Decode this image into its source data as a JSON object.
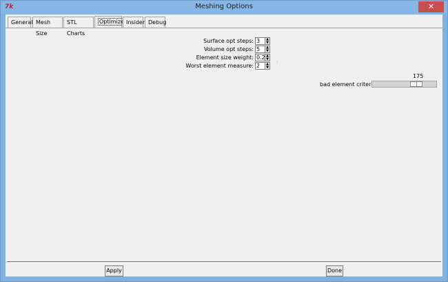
{
  "window": {
    "title": "Meshing Options",
    "app_icon_text": "7k",
    "close_symbol": "✕"
  },
  "tabs": [
    {
      "label": "General",
      "active": false
    },
    {
      "label": "Mesh Size",
      "active": false
    },
    {
      "label": "STL Charts",
      "active": false
    },
    {
      "label": "Optimizer",
      "active": true
    },
    {
      "label": "Insider",
      "active": false
    },
    {
      "label": "Debug",
      "active": false
    }
  ],
  "optimizer": {
    "fields": [
      {
        "label": "Surface opt steps:",
        "value": "3"
      },
      {
        "label": "Volume opt steps:",
        "value": "5"
      },
      {
        "label": "Element size weight:",
        "value": "0.2"
      },
      {
        "label": "Worst element measure:",
        "value": "2"
      }
    ],
    "bad_element": {
      "label": "bad element criterion",
      "value": "175",
      "level_fraction": 0.73
    }
  },
  "buttons": {
    "apply": "Apply",
    "done": "Done"
  }
}
